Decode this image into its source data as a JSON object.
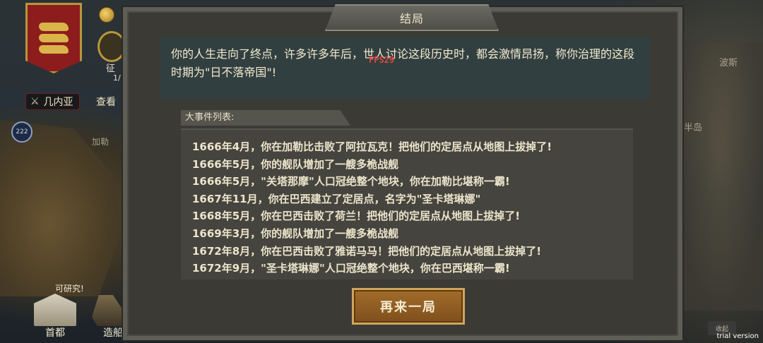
{
  "hud": {
    "conquest_label": "征",
    "counter_label": "1/",
    "region_name": "几内亚",
    "view_label": "查看",
    "circle_button_label": "222",
    "research_tag": "可研究!",
    "capital_label": "首都",
    "ship_label": "造船",
    "right_button_label": "收起",
    "trial_text": "trial version"
  },
  "map": {
    "label_persia": "波斯",
    "label_peninsula": "白半岛",
    "label_caribbean": "加勒"
  },
  "dialog": {
    "title": "结局",
    "message_line1": "你的人生走向了终点，许多许多年后，世人讨论这段历史时，都会激情昂扬，称你治理的这段",
    "message_line2": "时期为\"日不落帝国\"!",
    "fps_overlay": "FPS29",
    "events_header": "大事件列表:",
    "events": [
      "1666年4月，你在加勒比击败了阿拉瓦克！把他们的定居点从地图上拔掉了!",
      "1666年5月，你的舰队增加了一艘多桅战舰",
      "1666年5月，\"关塔那摩\"人口冠绝整个地块，你在加勒比堪称一霸!",
      "1667年11月，你在巴西建立了定居点，名字为\"圣卡塔琳娜\"",
      "1668年5月，你在巴西击败了荷兰！把他们的定居点从地图上拔掉了!",
      "1669年3月，你的舰队增加了一艘多桅战舰",
      "1672年8月，你在巴西击败了雅诺马马！把他们的定居点从地图上拔掉了!",
      "1672年9月，\"圣卡塔琳娜\"人口冠绝整个地块，你在巴西堪称一霸!"
    ],
    "replay_button": "再来一局"
  },
  "colors": {
    "dialog_bg": "#3b3a35",
    "message_bg": "#323f40",
    "button_gold": "#a26c2b",
    "banner_red": "#8d1d1d",
    "fps_red": "#e2463d"
  }
}
